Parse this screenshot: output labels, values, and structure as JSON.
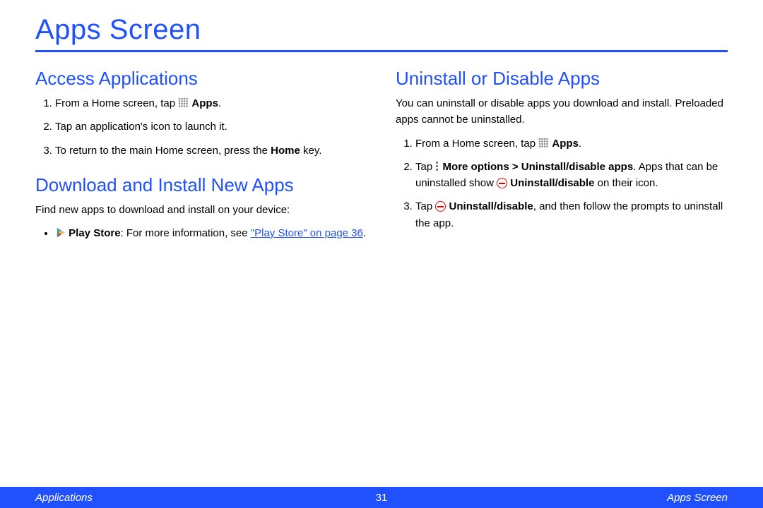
{
  "page_title": "Apps Screen",
  "left": {
    "access": {
      "heading": "Access Applications",
      "step1_a": "From a Home screen, tap ",
      "step1_b": "Apps",
      "step1_c": ".",
      "step2": "Tap an application's icon to launch it.",
      "step3_a": "To return to the main Home screen, press the ",
      "step3_b": "Home",
      "step3_c": " key."
    },
    "download": {
      "heading": "Download and Install New Apps",
      "intro": "Find new apps to download and install on your device:",
      "bullet_a": "Play Store",
      "bullet_b": ": For more information, see ",
      "bullet_link": "\"Play Store\" on page 36",
      "bullet_c": "."
    }
  },
  "right": {
    "uninstall": {
      "heading": "Uninstall or Disable Apps",
      "intro": "You can uninstall or disable apps you download and install. Preloaded apps cannot be uninstalled.",
      "step1_a": "From a Home screen, tap ",
      "step1_b": "Apps",
      "step1_c": ".",
      "step2_a": "Tap ",
      "step2_b": "More options > Uninstall/disable apps",
      "step2_c": ". Apps that can be uninstalled show ",
      "step2_d": "Uninstall/disable",
      "step2_e": " on their icon.",
      "step3_a": "Tap ",
      "step3_b": "Uninstall/disable",
      "step3_c": ", and then follow the prompts to uninstall the app."
    }
  },
  "footer": {
    "left": "Applications",
    "center": "31",
    "right": "Apps Screen"
  }
}
